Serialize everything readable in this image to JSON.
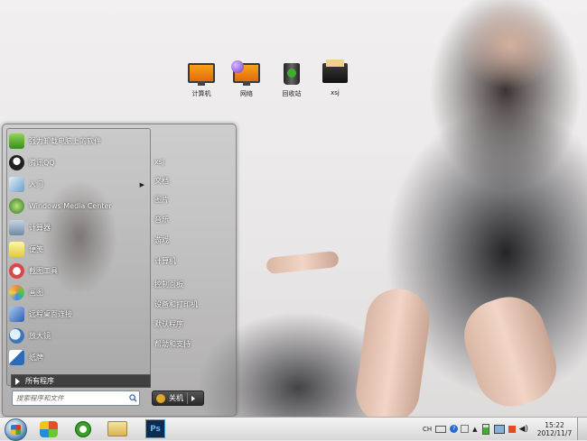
{
  "desktop": {
    "icons": [
      {
        "label": "计算机",
        "icon": "computer-icon"
      },
      {
        "label": "网络",
        "icon": "network-icon"
      },
      {
        "label": "回收站",
        "icon": "recycle-bin-icon"
      },
      {
        "label": "xsj",
        "icon": "folder-icon"
      }
    ]
  },
  "start_menu": {
    "programs": [
      {
        "label": "强力卸载电脑上的软件",
        "icon": "uninstall-icon",
        "color": "#5cae2e"
      },
      {
        "label": "腾讯QQ",
        "icon": "qq-penguin-icon",
        "color": "#222222"
      },
      {
        "label": "入门",
        "icon": "getting-started-icon",
        "color": "#8fb7da"
      },
      {
        "label": "Windows Media Center",
        "icon": "media-center-icon",
        "color": "#3c8a2d"
      },
      {
        "label": "计算器",
        "icon": "calculator-icon",
        "color": "#7b95b0"
      },
      {
        "label": "便笺",
        "icon": "sticky-notes-icon",
        "color": "#e8d64a"
      },
      {
        "label": "截图工具",
        "icon": "snipping-tool-icon",
        "color": "#d94848"
      },
      {
        "label": "画图",
        "icon": "paint-icon",
        "color": "#5ea0d8"
      },
      {
        "label": "远程桌面连接",
        "icon": "remote-desktop-icon",
        "color": "#3b72c4"
      },
      {
        "label": "放大镜",
        "icon": "magnifier-icon",
        "color": "#6aa5dc"
      },
      {
        "label": "纸牌",
        "icon": "solitaire-icon",
        "color": "#2d6ab8"
      }
    ],
    "all_programs": "所有程序",
    "search_placeholder": "搜索程序和文件",
    "right_items": [
      "xsj",
      "文档",
      "图片",
      "音乐",
      "游戏",
      "计算机",
      "控制面板",
      "设备和打印机",
      "默认程序",
      "帮助和支持"
    ],
    "shutdown_label": "关机"
  },
  "taskbar": {
    "pinned": [
      {
        "name": "media-player",
        "icon": "media-player-icon"
      },
      {
        "name": "internet-explorer",
        "icon": "ie-icon"
      },
      {
        "name": "explorer",
        "icon": "folder-icon"
      },
      {
        "name": "photoshop",
        "icon": "photoshop-icon",
        "text": "Ps"
      }
    ],
    "language": "CH",
    "time": "15:22",
    "date": "2012/11/7"
  }
}
